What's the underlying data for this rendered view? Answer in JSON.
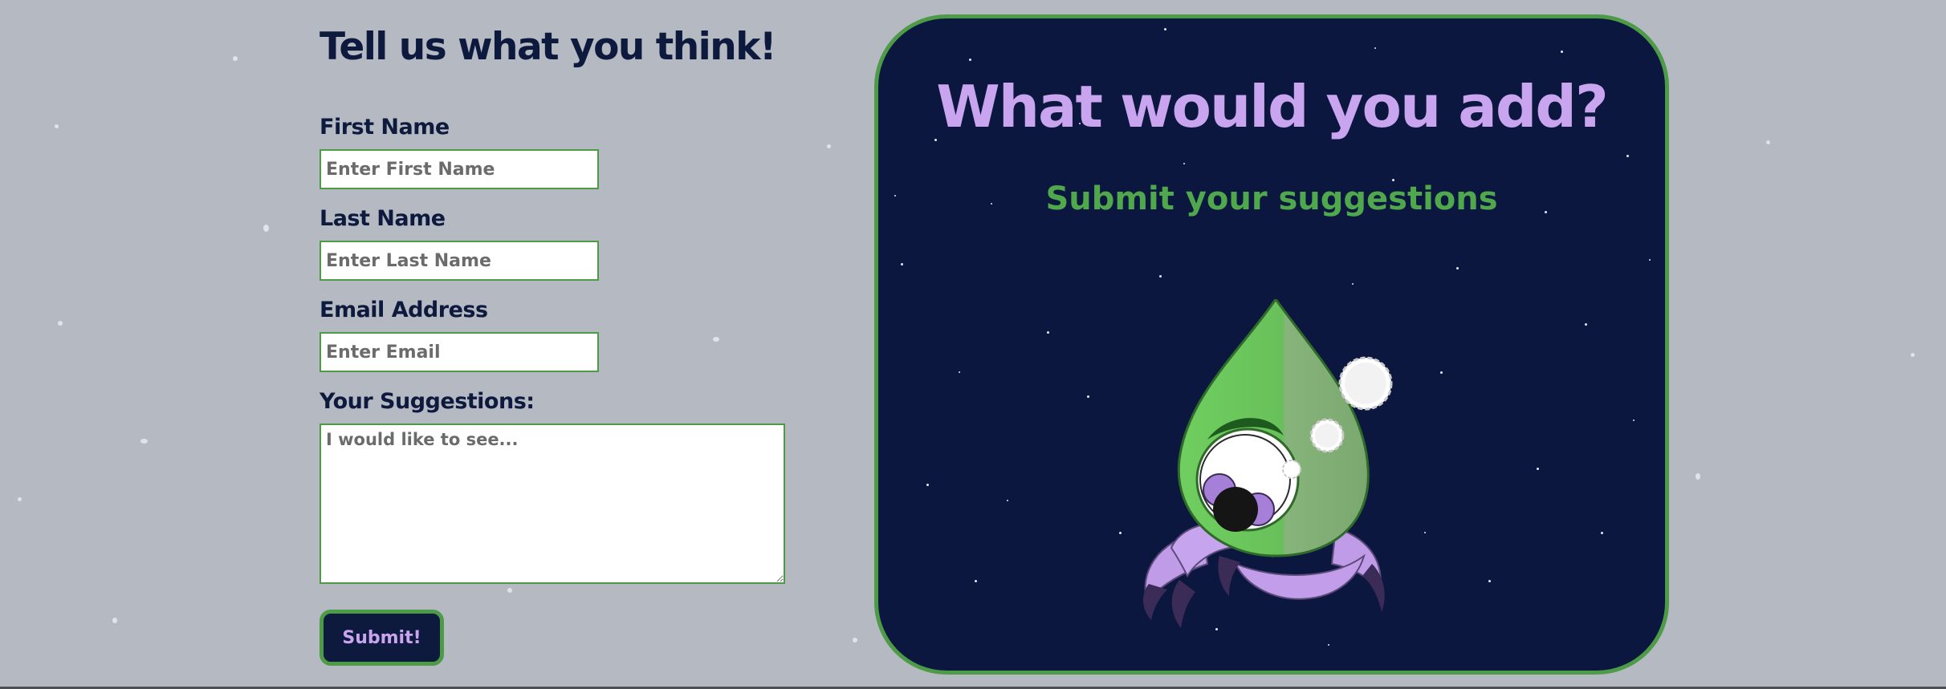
{
  "form": {
    "title": "Tell us what you think!",
    "first_name_label": "First Name",
    "first_name_placeholder": "Enter First Name",
    "last_name_label": "Last Name",
    "last_name_placeholder": "Enter Last Name",
    "email_label": "Email Address",
    "email_placeholder": "Enter Email",
    "suggestions_label": "Your Suggestions:",
    "suggestions_placeholder": "I would like to see...",
    "submit_label": "Submit!"
  },
  "card": {
    "title": "What would you add?",
    "subtitle": "Submit your suggestions"
  },
  "colors": {
    "page_background": "#b5b9c2",
    "card_background": "#0b173f",
    "accent_green": "#4e9b47",
    "accent_purple": "#c8a5ee",
    "heading_navy": "#0d1a3d"
  },
  "icons": [
    "alien-rocket-illustration"
  ]
}
